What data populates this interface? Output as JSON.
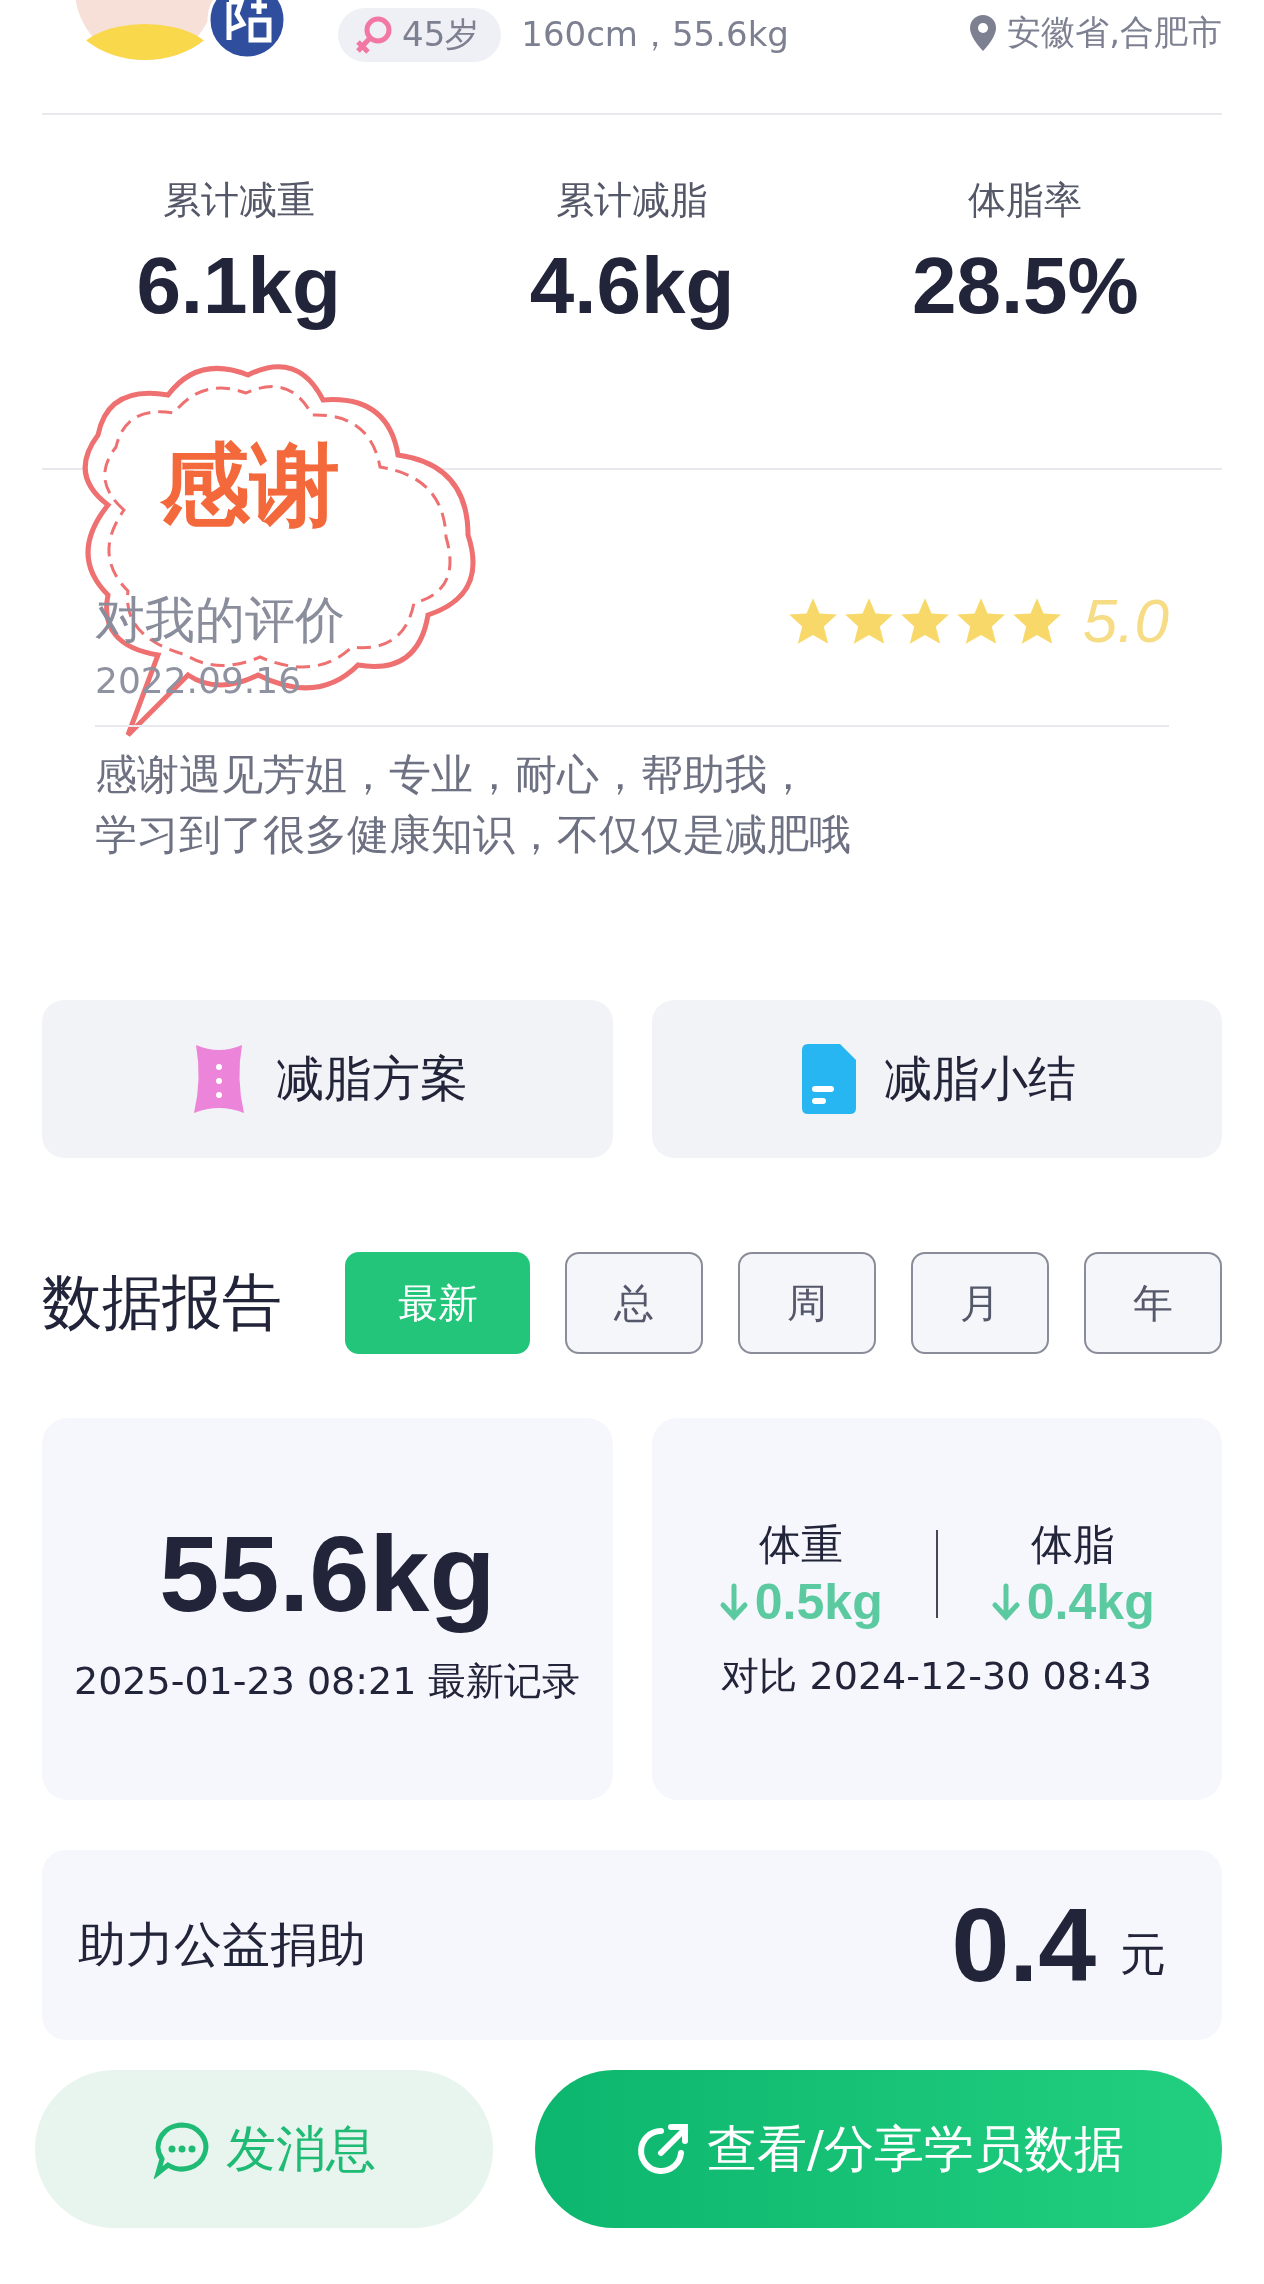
{
  "profile": {
    "age": "45岁",
    "body": "160cm，55.6kg",
    "location": "安徽省,合肥市"
  },
  "stats": [
    {
      "label": "累计减重",
      "value": "6.1kg"
    },
    {
      "label": "累计减脂",
      "value": "4.6kg"
    },
    {
      "label": "体脂率",
      "value": "28.5%"
    }
  ],
  "review": {
    "sticker": "感谢",
    "title": "对我的评价",
    "date": "2022.09.16",
    "stars": 5,
    "score": "5.0",
    "lines": [
      "感谢遇见芳姐，专业，耐心，帮助我，",
      "学习到了很多健康知识，不仅仅是减肥哦"
    ]
  },
  "shortcuts": [
    {
      "kind": "plan",
      "label": "减脂方案"
    },
    {
      "kind": "summary",
      "label": "减脂小结"
    }
  ],
  "report": {
    "title": "数据报告",
    "tabs": [
      {
        "label": "最新",
        "selected": true
      },
      {
        "label": "总",
        "selected": false
      },
      {
        "label": "周",
        "selected": false
      },
      {
        "label": "月",
        "selected": false
      },
      {
        "label": "年",
        "selected": false
      }
    ],
    "latest": {
      "value": "55.6kg",
      "caption": "2025-01-23 08:21 最新记录"
    },
    "changes": [
      {
        "label": "体重",
        "value": "0.5kg"
      },
      {
        "label": "体脂",
        "value": "0.4kg"
      }
    ],
    "compare": "对比 2024-12-30 08:43"
  },
  "donation": {
    "label": "助力公益捐助",
    "amount": "0.4",
    "unit": "元"
  },
  "actions": [
    {
      "kind": "message",
      "label": "发消息"
    },
    {
      "kind": "share",
      "label": "查看/分享学员数据"
    }
  ]
}
